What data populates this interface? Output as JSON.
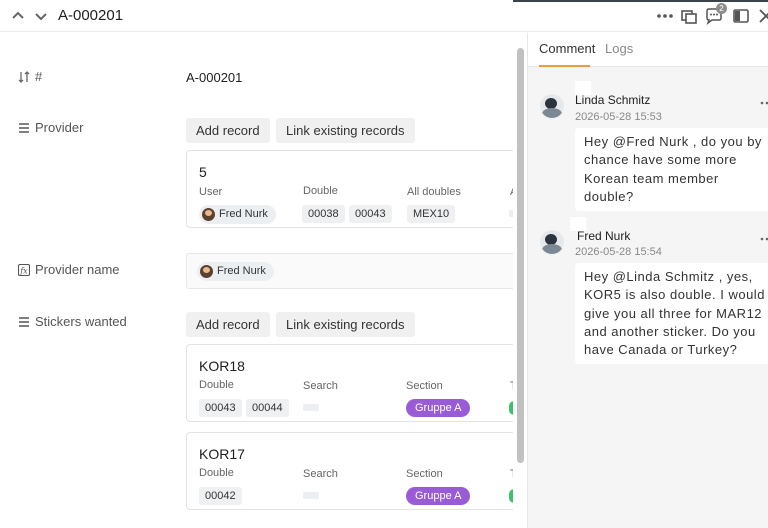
{
  "header": {
    "record_id": "A-000201",
    "comment_badge": "2"
  },
  "fields": {
    "id": {
      "label": "#",
      "value": "A-000201"
    },
    "provider": {
      "label": "Provider",
      "add_button": "Add record",
      "link_button": "Link existing records",
      "card": {
        "title": "5",
        "col_user": "User",
        "col_double": "Double",
        "col_alldoubles": "All doubles",
        "col_cut": "A",
        "user": "Fred Nurk",
        "double": [
          "00038",
          "00043"
        ],
        "alldoubles": [
          "MEX10"
        ]
      }
    },
    "provider_name": {
      "label": "Provider name",
      "value": "Fred Nurk"
    },
    "stickers": {
      "label": "Stickers wanted",
      "add_button": "Add record",
      "link_button": "Link existing records",
      "cards": [
        {
          "title": "KOR18",
          "col_double": "Double",
          "col_search": "Search",
          "col_section": "Section",
          "col_cut": "T",
          "double": [
            "00043",
            "00044"
          ],
          "section": "Gruppe A"
        },
        {
          "title": "KOR17",
          "col_double": "Double",
          "col_search": "Search",
          "col_section": "Section",
          "col_cut": "T",
          "double": [
            "00042"
          ],
          "section": "Gruppe A"
        }
      ]
    }
  },
  "panel": {
    "tabs": [
      "Comment",
      "Logs"
    ],
    "active_tab": "Comment",
    "comments": [
      {
        "author": "Linda Schmitz",
        "time": "2026-05-28 15:53",
        "lines": [
          "Hey @Fred Nurk , do you by",
          "chance have some more",
          "Korean team member",
          "double?"
        ]
      },
      {
        "author": "Fred Nurk",
        "time": "2026-05-28 15:54",
        "lines": [
          "Hey @Linda Schmitz , yes,",
          "KOR5 is also double. I would",
          "give you all three for MAR12",
          "and another sticker. Do you",
          "have Canada or Turkey?"
        ]
      }
    ]
  },
  "colors": {
    "section_chip": "#9a5cd6",
    "tab_underline": "#f09a3e",
    "status_green": "#3ec16b"
  },
  "icons": [
    "chevron-up-icon",
    "chevron-down-icon",
    "more-icon",
    "expand-icon",
    "comment-icon",
    "sidebar-icon",
    "close-icon",
    "autonumber-icon",
    "link-field-icon",
    "formula-icon"
  ]
}
